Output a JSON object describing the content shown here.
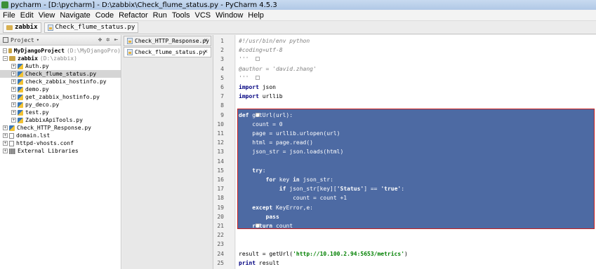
{
  "window": {
    "title": "pycharm - [D:\\pycharm] - D:\\zabbix\\Check_flume_status.py - PyCharm 4.5.3"
  },
  "menu": [
    "File",
    "Edit",
    "View",
    "Navigate",
    "Code",
    "Refactor",
    "Run",
    "Tools",
    "VCS",
    "Window",
    "Help"
  ],
  "breadcrumb": {
    "folder": "zabbix",
    "file": "Check_flume_status.py"
  },
  "project_panel": {
    "title": "Project",
    "tool_icons": [
      "collapse-all-icon",
      "settings-icon",
      "hide-icon"
    ],
    "tree": [
      {
        "label": "MyDjangoProject",
        "path": "D:\\MyDjangoPro",
        "kind": "folder",
        "level": 0,
        "bold": true
      },
      {
        "label": "zabbix",
        "path": "D:\\zabbix",
        "kind": "folder",
        "level": 0,
        "bold": true
      },
      {
        "label": "Auth.py",
        "kind": "py",
        "level": 1
      },
      {
        "label": "Check_flume_status.py",
        "kind": "py",
        "level": 1,
        "selected": true
      },
      {
        "label": "check_zabbix_hostinfo.py",
        "kind": "py",
        "level": 1
      },
      {
        "label": "demo.py",
        "kind": "py",
        "level": 1
      },
      {
        "label": "get_zabbix_hostinfo.py",
        "kind": "py",
        "level": 1
      },
      {
        "label": "py_deco.py",
        "kind": "py",
        "level": 1
      },
      {
        "label": "test.py",
        "kind": "py",
        "level": 1
      },
      {
        "label": "ZabbixApiTools.py",
        "kind": "py",
        "level": 1
      },
      {
        "label": "Check_HTTP_Response.py",
        "kind": "py",
        "level": 0
      },
      {
        "label": "domain.lst",
        "kind": "txt",
        "level": 0
      },
      {
        "label": "httpd-vhosts.conf",
        "kind": "txt",
        "level": 0
      },
      {
        "label": "External Libraries",
        "kind": "lib",
        "level": 0
      }
    ]
  },
  "editor_tabs": [
    {
      "label": "Check_HTTP_Response.py",
      "close": "×",
      "active": false
    },
    {
      "label": "Check_flume_status.py",
      "close": "×",
      "active": true
    }
  ],
  "code": {
    "line_numbers": [
      "1",
      "2",
      "3",
      "4",
      "5",
      "6",
      "7",
      "8",
      "9",
      "10",
      "11",
      "12",
      "13",
      "14",
      "15",
      "16",
      "17",
      "18",
      "19",
      "20",
      "21",
      "22",
      "23",
      "24",
      "25"
    ],
    "lines": [
      "#!/usr/bin/env python",
      "#coding=utf-8",
      "'''",
      "@author = 'david.zhang'",
      "'''",
      "import json",
      "import urllib",
      "",
      "def getUrl(url):",
      "    count = 0",
      "    page = urllib.urlopen(url)",
      "    html = page.read()",
      "    json_str = json.loads(html)",
      "",
      "    try:",
      "        for key in json_str:",
      "            if json_str[key]['Status'] == 'true':",
      "                count = count +1",
      "    except KeyError,e:",
      "        pass",
      "    return count",
      "",
      "",
      "result = getUrl('http://10.100.2.94:5653/metrics')",
      "print result"
    ]
  }
}
